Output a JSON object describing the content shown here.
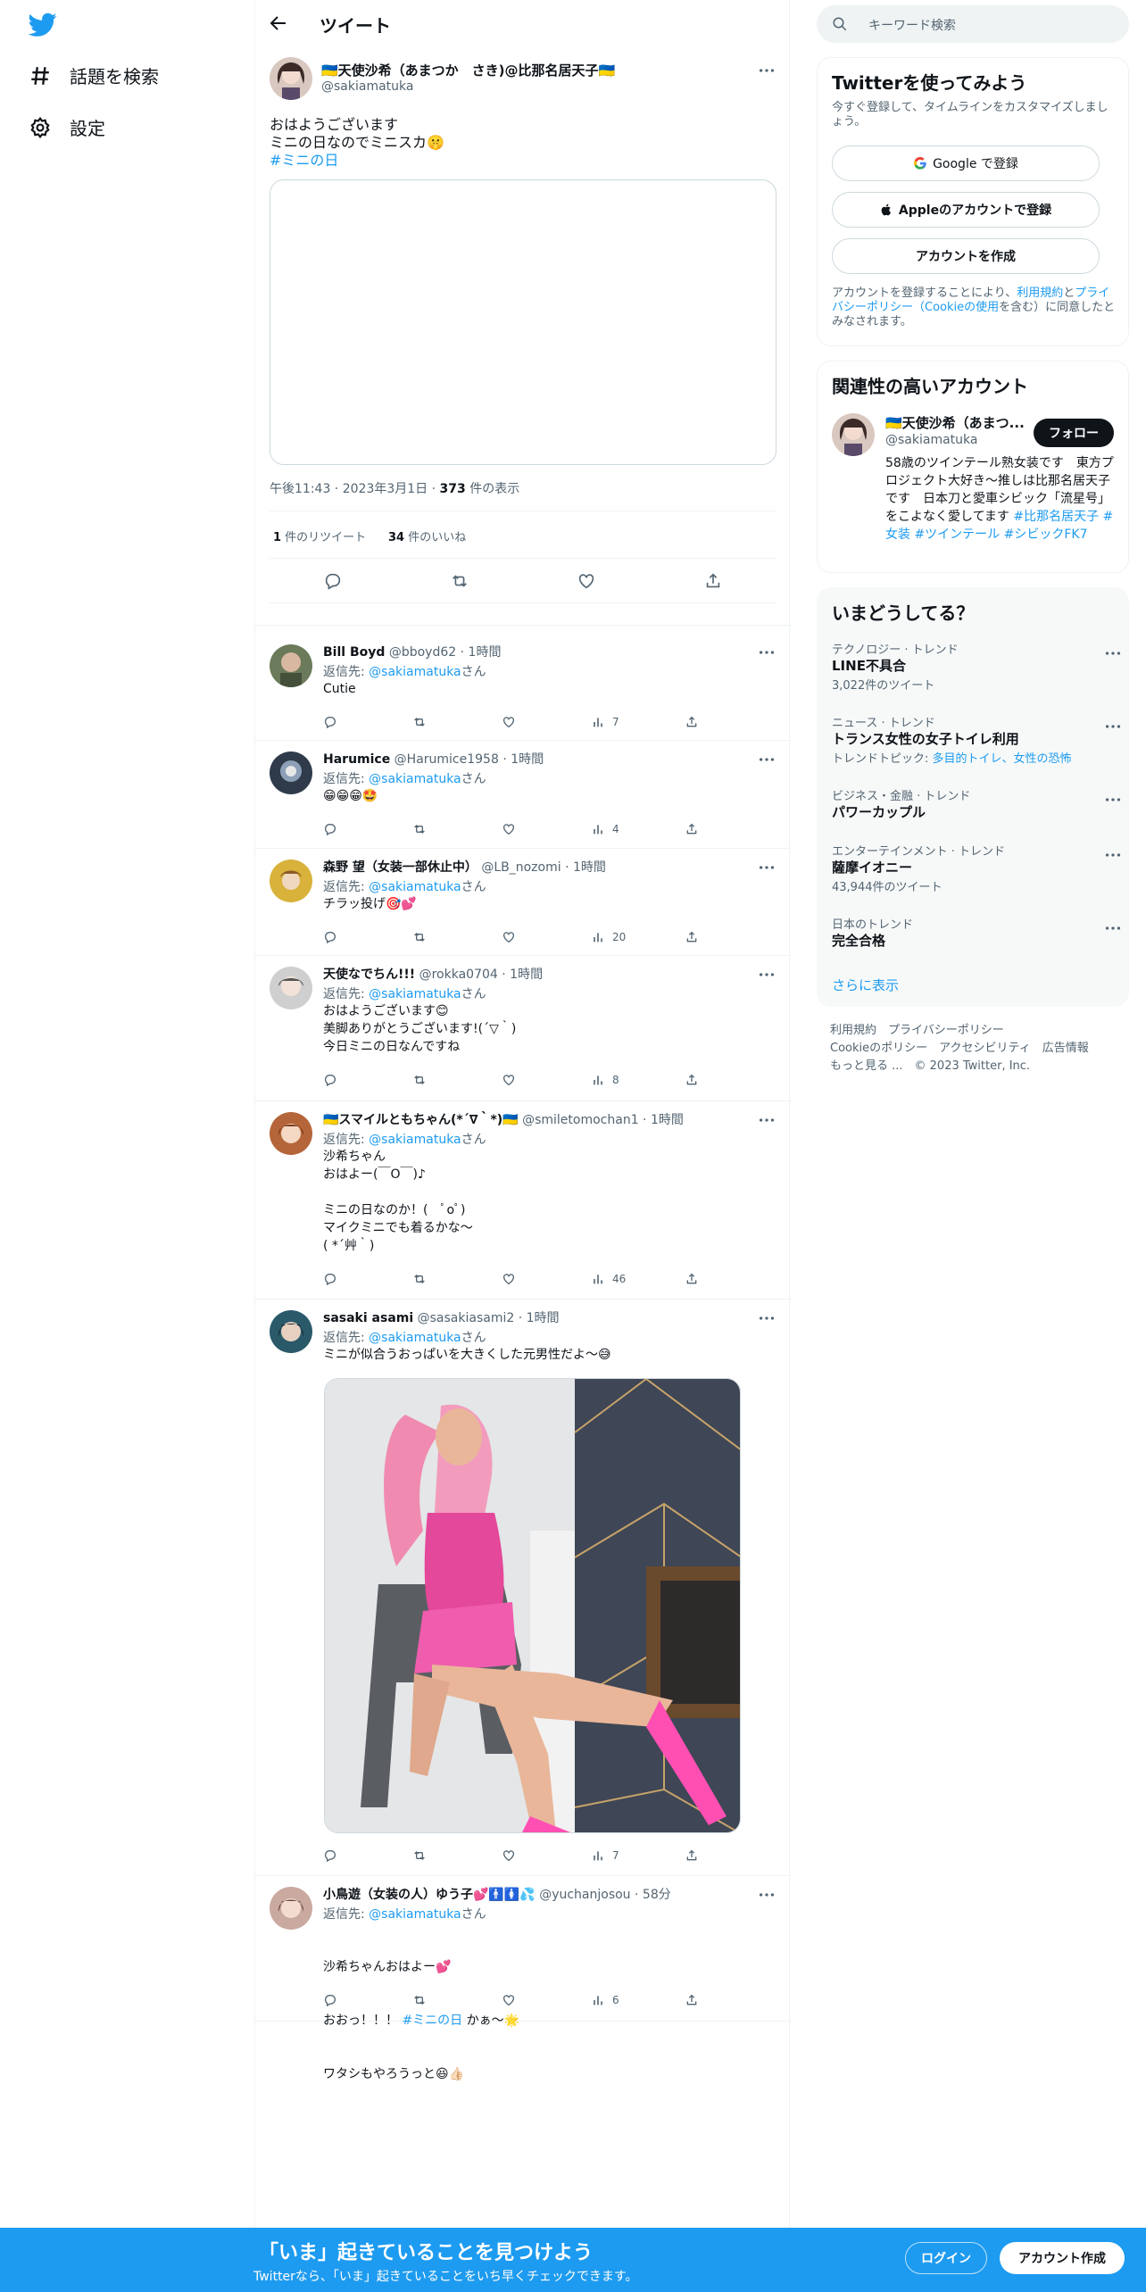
{
  "nav": {
    "explore_label": "話題を検索",
    "settings_label": "設定"
  },
  "header": {
    "title": "ツイート"
  },
  "main_tweet": {
    "author_name": "🇺🇦天使沙希（あまつか　さき)@比那名居天子🇺🇦",
    "author_handle": "@sakiamatuka",
    "text_line1": "おはようございます",
    "text_line2": "ミニの日なのでミニスカ🤫",
    "hashtag": "#ミニの日",
    "time": "午後11:43",
    "date": "2023年3月1日",
    "views_count": "373",
    "views_label": " 件の表示",
    "retweets_count": "1",
    "retweets_label": " 件のリツイート",
    "likes_count": "34",
    "likes_label": " 件のいいね"
  },
  "replies": [
    {
      "name": "Bill Boyd",
      "handle": "@bboyd62",
      "time": "1時間",
      "reply_prefix": "返信先: ",
      "reply_to": "@sakiamatuka",
      "reply_suffix": "さん",
      "body": "Cutie",
      "views": "7",
      "avatar_color": "#6b7a5a"
    },
    {
      "name": "Harumice",
      "handle": "@Harumice1958",
      "time": "1時間",
      "reply_prefix": "返信先: ",
      "reply_to": "@sakiamatuka",
      "reply_suffix": "さん",
      "body": "😁😁😁🤩",
      "views": "4",
      "avatar_color": "#2f3a4a"
    },
    {
      "name": "森野 望（女装一部休止中）",
      "handle": "@LB_nozomi",
      "time": "1時間",
      "reply_prefix": "返信先: ",
      "reply_to": "@sakiamatuka",
      "reply_suffix": "さん",
      "body": "チラッ投げ🎯💕",
      "views": "20",
      "avatar_color": "#d8b23a"
    },
    {
      "name": "天使なでちん!!!",
      "handle": "@rokka0704",
      "time": "1時間",
      "reply_prefix": "返信先: ",
      "reply_to": "@sakiamatuka",
      "reply_suffix": "さん",
      "body": "おはようございます😊\n美脚ありがとうございます!(´▽｀)\n今日ミニの日なんですね",
      "views": "8",
      "avatar_color": "#8c8c8c"
    },
    {
      "name": "🇺🇦スマイルともちゃん(*´∇｀*)🇺🇦",
      "handle": "@smiletomochan1",
      "time": "1時間",
      "reply_prefix": "返信先: ",
      "reply_to": "@sakiamatuka",
      "reply_suffix": "さん",
      "body": "沙希ちゃん\nおはよー(￣O￣)♪\n\nミニの日なのか！(　ﾟoﾟ)\nマイクミニでも着るかな～\n( *´艸｀)",
      "views": "46",
      "avatar_color": "#b5653a"
    },
    {
      "name": "sasaki asami",
      "handle": "@sasakiasami2",
      "time": "1時間",
      "reply_prefix": "返信先: ",
      "reply_to": "@sakiamatuka",
      "reply_suffix": "さん",
      "body": "ミニが似合うおっぱいを大きくした元男性だよ〜😅",
      "views": "7",
      "avatar_color": "#2a5a6a"
    },
    {
      "name": "小鳥遊（女装の人）ゆう子💕🚹🚺💦",
      "handle": "@yuchanjosou",
      "time": "58分",
      "reply_prefix": "返信先: ",
      "reply_to": "@sakiamatuka",
      "reply_suffix": "さん",
      "body_line1": "沙希ちゃんおはよー💕",
      "body_line2_pre": "おおっ！！！ ",
      "body_line2_tag": "#ミニの日",
      "body_line2_post": " かぁ～🌟",
      "body_line3": "ワタシもやろうっと😆👍🏻",
      "views": "6",
      "avatar_color": "#c9a9a0"
    }
  ],
  "sidebar": {
    "search_placeholder": "キーワード検索",
    "signup_card": {
      "title": "Twitterを使ってみよう",
      "subtitle": "今すぐ登録して、タイムラインをカスタマイズしましょう。",
      "google_label": "Google で登録",
      "apple_label": "Appleのアカウントで登録",
      "create_label": "アカウントを作成",
      "legal_pre": "アカウントを登録することにより、",
      "legal_terms": "利用規約",
      "legal_and": "と",
      "legal_privacy": "プライバシーポリシー（Cookieの使用",
      "legal_post": "を含む）に同意したとみなされます。"
    },
    "related_card": {
      "title": "関連性の高いアカウント",
      "name": "🇺🇦天使沙希（あまつ...",
      "handle": "@sakiamatuka",
      "follow_label": "フォロー",
      "bio_plain": "58歳のツインテール熟女装です　東方プロジェクト大好き～推しは比那名居天子です　日本刀と愛車シビック「流星号」をこよなく愛してます ",
      "bio_tag1": "#比那名居天子",
      "bio_tag2": "#女装",
      "bio_tag3": "#ツインテール",
      "bio_tag4": "#シビックFK7"
    },
    "trends_card": {
      "title": "いまどうしてる？",
      "trends": [
        {
          "category": "テクノロジー · トレンド",
          "title": "LINE不具合",
          "count": "3,022件のツイート"
        },
        {
          "category": "ニュース · トレンド",
          "title": "トランス女性の女子トイレ利用",
          "count_pre": "トレンドトピック: ",
          "count_links": "多目的トイレ、女性の恐怖"
        },
        {
          "category": "ビジネス・金融 · トレンド",
          "title": "パワーカップル"
        },
        {
          "category": "エンターテインメント · トレンド",
          "title": "薩摩イオニー",
          "count": "43,944件のツイート"
        },
        {
          "category": "日本のトレンド",
          "title": "完全合格"
        }
      ],
      "show_more": "さらに表示"
    },
    "footer": {
      "line1": "利用規約　プライバシーポリシー",
      "line2": "Cookieのポリシー　アクセシビリティ　広告情報",
      "line3": "もっと見る ...　© 2023 Twitter, Inc."
    }
  },
  "bottombar": {
    "title": "「いま」起きていることを見つけよう",
    "subtitle": "Twitterなら、「いま」起きていることをいち早くチェックできます。",
    "login_label": "ログイン",
    "signup_label": "アカウント作成"
  },
  "colors": {
    "accent": "#1d9bf0",
    "text": "#0f1419",
    "muted": "#536471",
    "border": "#eff3f4"
  }
}
